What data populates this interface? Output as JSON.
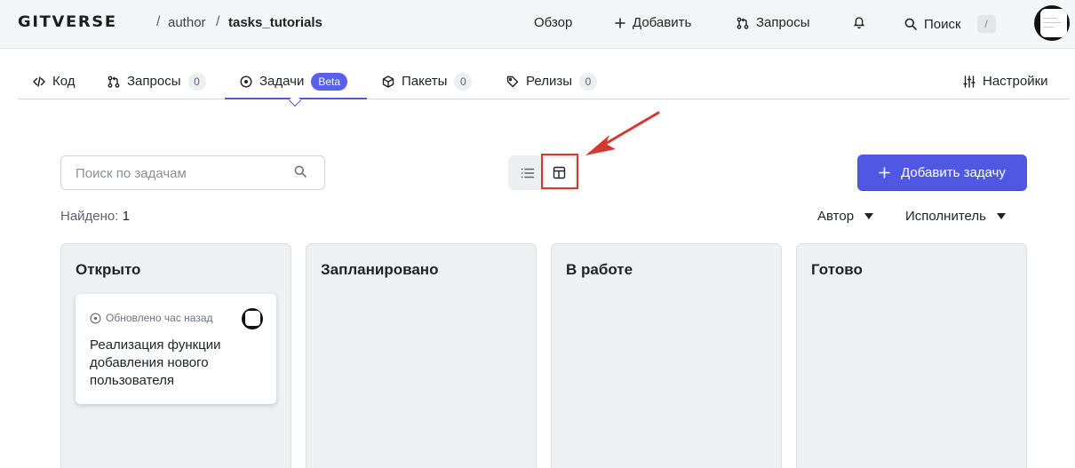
{
  "header": {
    "logo": "GITVERSE",
    "breadcrumb": {
      "separator": "/",
      "owner": "author",
      "repo": "tasks_tutorials"
    },
    "nav": {
      "overview": "Обзор",
      "add": "Добавить",
      "requests": "Запросы",
      "search": "Поиск",
      "search_shortcut": "/"
    },
    "icons": {
      "add": "plus-icon",
      "requests": "pull-request-icon",
      "notifications": "bell-icon",
      "search": "search-icon",
      "avatar": "user-avatar"
    }
  },
  "tabs": [
    {
      "label": "Код",
      "icon": "code-icon"
    },
    {
      "label": "Запросы",
      "count": "0",
      "icon": "pull-request-icon"
    },
    {
      "label": "Задачи",
      "badge": "Beta",
      "icon": "issue-icon",
      "active": true
    },
    {
      "label": "Пакеты",
      "count": "0",
      "icon": "package-icon"
    },
    {
      "label": "Релизы",
      "count": "0",
      "icon": "tag-icon"
    }
  ],
  "settings_tab": {
    "label": "Настройки",
    "icon": "sliders-icon"
  },
  "toolbar": {
    "search_placeholder": "Поиск по задачам",
    "view_list_icon": "list-icon",
    "view_board_icon": "board-icon",
    "add_task": "Добавить задачу"
  },
  "summary": {
    "found_label": "Найдено:",
    "found_count": "1"
  },
  "filters": {
    "author": "Автор",
    "assignee": "Исполнитель"
  },
  "board": {
    "columns": [
      {
        "title": "Открыто",
        "cards": [
          {
            "updated": "Обновлено час назад",
            "title": "Реализация функции добавления нового пользователя"
          }
        ]
      },
      {
        "title": "Запланировано",
        "cards": []
      },
      {
        "title": "В работе",
        "cards": []
      },
      {
        "title": "Готово",
        "cards": []
      }
    ]
  },
  "colors": {
    "accent": "#4f57e3",
    "annotation": "#d23a2e",
    "column_bg": "#eef0f3",
    "header_bg": "#f4f5f7"
  }
}
